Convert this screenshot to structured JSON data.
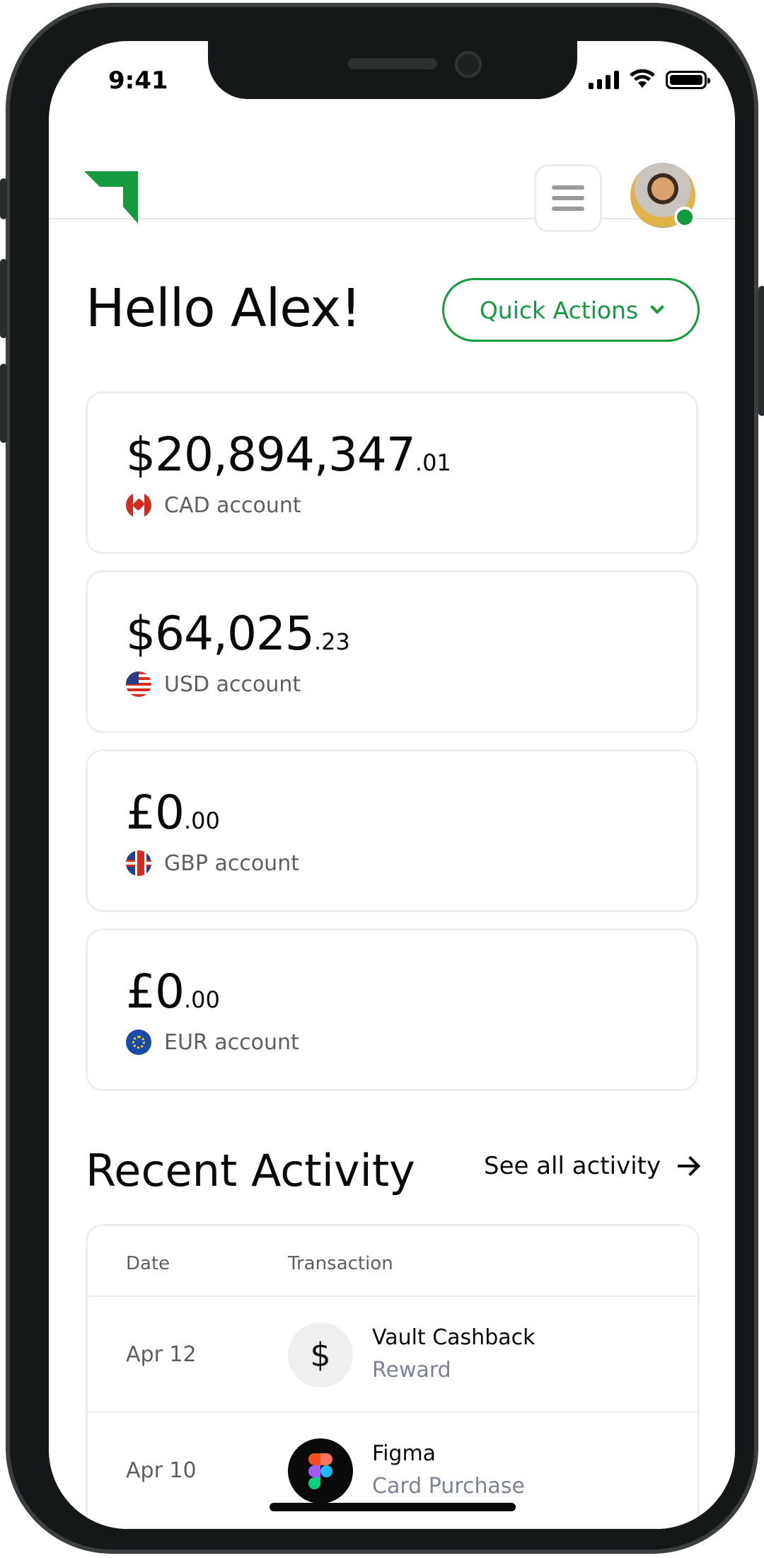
{
  "status_bar": {
    "time": "9:41"
  },
  "header": {
    "menu_icon": "hamburger-icon",
    "avatar_status": "online"
  },
  "greeting": "Hello Alex!",
  "quick_actions": {
    "label": "Quick Actions",
    "icon": "chevron-down-icon"
  },
  "accounts": [
    {
      "whole": "$20,894,347",
      "cents": ".01",
      "label": "CAD account",
      "flag": "canada-flag-icon"
    },
    {
      "whole": "$64,025",
      "cents": ".23",
      "label": "USD account",
      "flag": "us-flag-icon"
    },
    {
      "whole": "£0",
      "cents": ".00",
      "label": "GBP account",
      "flag": "uk-flag-icon"
    },
    {
      "whole": "£0",
      "cents": ".00",
      "label": "EUR account",
      "flag": "eu-flag-icon"
    }
  ],
  "recent_activity": {
    "title": "Recent Activity",
    "see_all": "See all activity",
    "columns": [
      "Date",
      "Transaction"
    ],
    "rows": [
      {
        "date": "Apr 12",
        "icon_text": "$",
        "icon": "dollar-icon",
        "name": "Vault Cashback",
        "type": "Reward"
      },
      {
        "date": "Apr 10",
        "icon": "figma-icon",
        "name": "Figma",
        "type": "Card Purchase"
      }
    ]
  },
  "colors": {
    "brand_green": "#149a3f",
    "muted_text": "#5b5f64",
    "secondary_text": "#7b8394"
  }
}
